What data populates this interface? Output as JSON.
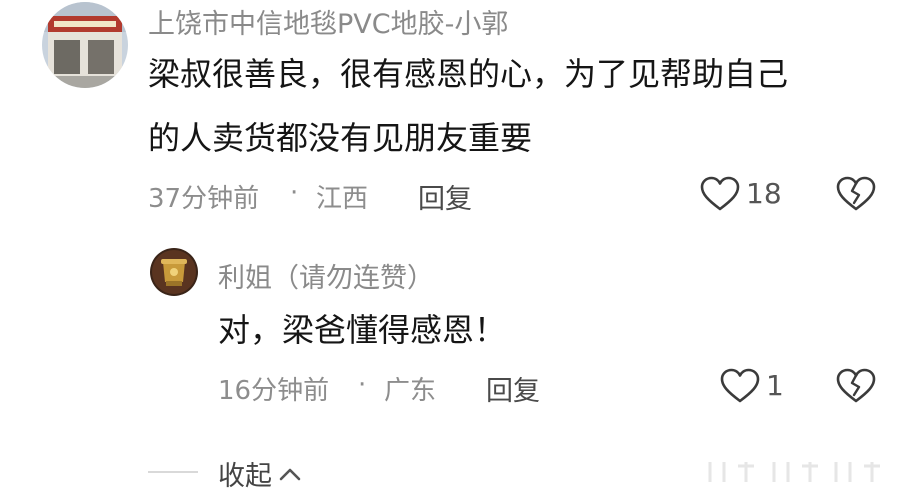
{
  "comments": [
    {
      "author": "上饶市中信地毯PVC地胶-小郭",
      "text_line1": "梁叔很善良，很有感恩的心，为了见帮助自己",
      "text_line2": "的人卖货都没有见朋友重要",
      "time": "37分钟前",
      "separator": "·",
      "location": "江西",
      "reply_label": "回复",
      "likes": "18",
      "like_icon": "heart-outline-icon",
      "dislike_icon": "broken-heart-icon"
    },
    {
      "author": "利姐（请勿连赞）",
      "text": "对，梁爸懂得感恩！",
      "time": "16分钟前",
      "separator": "·",
      "location": "广东",
      "reply_label": "回复",
      "likes": "1",
      "like_icon": "heart-outline-icon",
      "dislike_icon": "broken-heart-icon"
    }
  ],
  "collapse": {
    "label": "收起",
    "icon": "chevron-up-icon"
  },
  "colors": {
    "text_primary": "#151515",
    "text_secondary": "#8a8a8a",
    "divider": "#d9d9d9"
  }
}
